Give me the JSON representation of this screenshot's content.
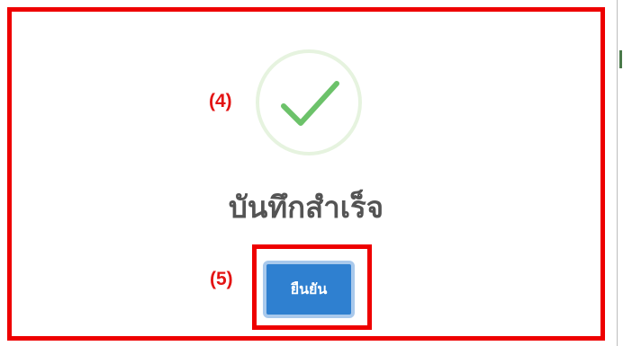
{
  "dialog": {
    "title": "บันทึกสำเร็จ",
    "icon": "success-check-icon",
    "confirm_label": "ยืนยัน"
  },
  "annotations": {
    "label_4": "(4)",
    "label_5": "(5)",
    "color": "#ee0000"
  },
  "colors": {
    "success_green": "#6cc26a",
    "success_ring": "#e6f3df",
    "button_blue": "#2f80d0",
    "title_gray": "#545454"
  }
}
